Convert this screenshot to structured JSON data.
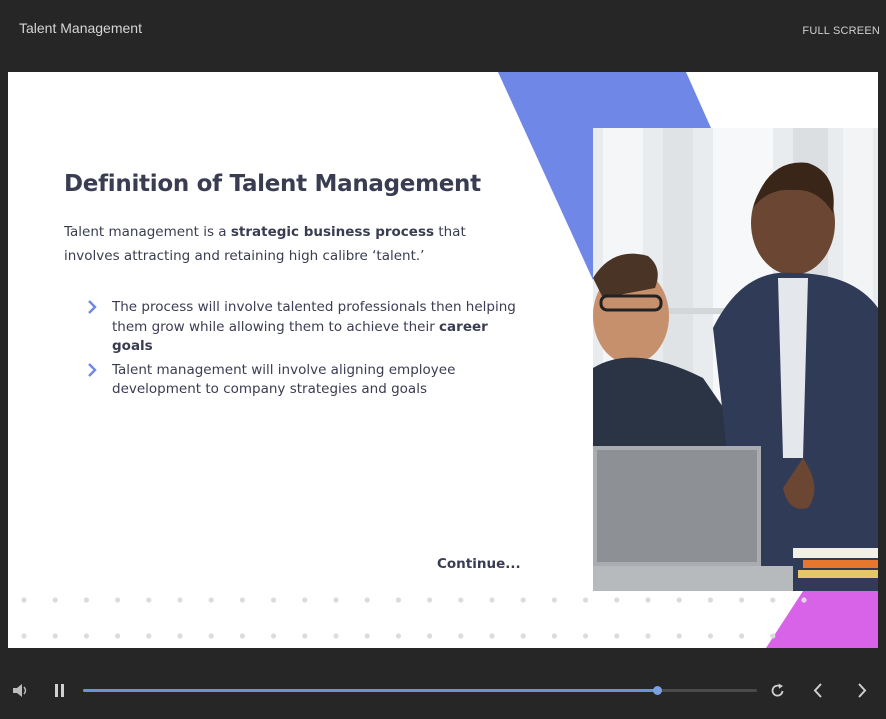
{
  "header": {
    "course_title": "Talent Management",
    "fullscreen_label": "FULL SCREEN"
  },
  "slide": {
    "heading": "Definition of Talent Management",
    "intro": {
      "before": "Talent management is a ",
      "bold": "strategic business process",
      "after": " that involves attracting and retaining high calibre ‘talent.’"
    },
    "bullets": [
      {
        "before": "The process will involve talented professionals then helping them grow while allowing them to achieve their ",
        "bold": "career goals",
        "after": ""
      },
      {
        "before": "Talent management will involve aligning employee development to company strategies and goals",
        "bold": "",
        "after": ""
      }
    ],
    "continue_label": "Continue...",
    "colors": {
      "accent_blue": "#6f87e6",
      "accent_pink": "#d963e8",
      "text": "#3a3d52",
      "dots": "#dcdcdc"
    }
  },
  "player": {
    "progress": 0.852,
    "icons": [
      "volume-icon",
      "pause-icon",
      "replay-icon",
      "previous-icon",
      "next-icon"
    ]
  }
}
